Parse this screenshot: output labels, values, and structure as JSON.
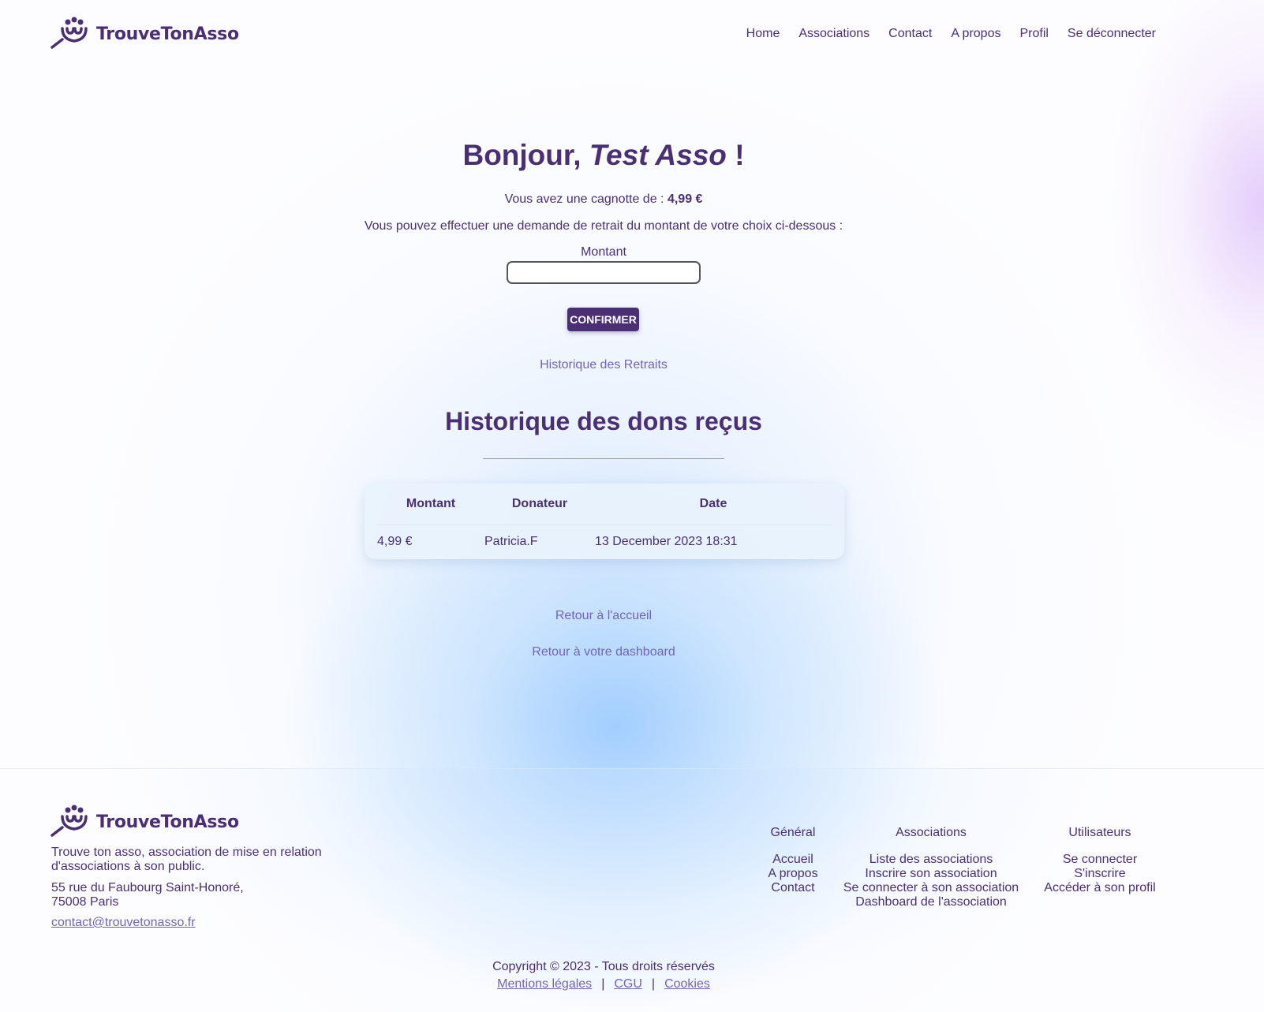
{
  "brand": {
    "name": "TrouveTonAsso",
    "color": "#4b2f74",
    "link_color": "#7264b8"
  },
  "nav": {
    "items": [
      "Home",
      "Associations",
      "Contact",
      "A propos",
      "Profil",
      "Se déconnecter"
    ]
  },
  "greeting": {
    "prefix": "Bonjour,",
    "name": "Test Asso",
    "suffix": "!"
  },
  "balance": {
    "text": "Vous avez une cagnotte de :",
    "amount": "4,99 €"
  },
  "withdrawal": {
    "instruction": "Vous pouvez effectuer une demande de retrait du montant de votre choix ci-dessous :",
    "amount_label": "Montant",
    "amount_value": "",
    "confirm_label": "CONFIRMER"
  },
  "history_link": "Historique des Retraits",
  "donations": {
    "title": "Historique des dons reçus",
    "columns": [
      "Montant",
      "Donateur",
      "Date"
    ],
    "rows": [
      {
        "amount": "4,99 €",
        "donor": "Patricia.F",
        "date": "13 December 2023 18:31"
      }
    ]
  },
  "links": {
    "back_home": "Retour à l'accueil",
    "back_dashboard": "Retour à votre dashboard"
  },
  "footer": {
    "description": "Trouve ton asso, association de mise en relation d'associations à son public.",
    "address_line1": "55 rue du Faubourg Saint-Honoré,",
    "address_line2": "75008 Paris",
    "email": "contact@trouvetonasso.fr",
    "columns": {
      "general": {
        "title": "Général",
        "items": [
          "Accueil",
          "A propos",
          "Contact"
        ]
      },
      "associations": {
        "title": "Associations",
        "items": [
          "Liste des associations",
          "Inscrire son association",
          "Se connecter à son association",
          "Dashboard de l'association"
        ]
      },
      "users": {
        "title": "Utilisateurs",
        "items": [
          "Se connecter",
          "S'inscrire",
          "Accéder à son profil"
        ]
      }
    },
    "copyright": "Copyright © 2023 - Tous droits réservés",
    "legal": [
      "Mentions légales",
      "CGU",
      "Cookies"
    ]
  }
}
